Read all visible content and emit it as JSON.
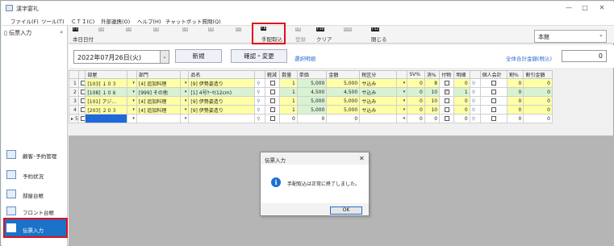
{
  "window": {
    "title": "漢字宴礼",
    "minimize": "—",
    "maximize": "□",
    "close": "✕"
  },
  "menu": [
    "ファイル(F)",
    "ツール(T)",
    "ＣＴＩ(C)",
    "外部連携(O)",
    "ヘルプ(H)",
    "チャットボット質問(Q)"
  ],
  "sidebar": {
    "header": "伝票入力",
    "collapse": "«",
    "items": [
      {
        "label": "顧客･予約管理",
        "icon": "customer-icon"
      },
      {
        "label": "予約状況",
        "icon": "calendar-icon"
      },
      {
        "label": "部屋台帳",
        "icon": "ledger-icon"
      },
      {
        "label": "フロント台帳",
        "icon": "front-ledger-icon"
      },
      {
        "label": "伝票入力",
        "icon": "slip-icon",
        "active": true
      }
    ]
  },
  "fkeys": [
    {
      "key": "F1",
      "label": "本日日付",
      "enabled": true
    },
    {
      "key": "F2",
      "label": "",
      "enabled": false
    },
    {
      "key": "F3",
      "label": "",
      "enabled": false
    },
    {
      "key": "F4",
      "label": "",
      "enabled": false
    },
    {
      "key": "F5",
      "label": "",
      "enabled": false
    },
    {
      "key": "F6",
      "label": "",
      "enabled": false
    },
    {
      "key": "F7",
      "label": "",
      "enabled": false
    },
    {
      "key": "F8",
      "label": "手配取込",
      "enabled": true
    },
    {
      "key": "F9",
      "label": "登録",
      "enabled": false
    },
    {
      "key": "F10",
      "label": "クリア",
      "enabled": true
    },
    {
      "key": "F11",
      "label": "",
      "enabled": false
    },
    {
      "key": "F12",
      "label": "閉じる",
      "enabled": true
    }
  ],
  "store_select": {
    "value": "本館",
    "chevron": "⌄"
  },
  "toolbar": {
    "date": "2022年07月26日(火)",
    "date_dd": "⌄",
    "new_button": "新規",
    "confirm_button": "確認・変更",
    "select_detail_link": "選択明細",
    "total_link": "全体合計金額(税込)",
    "total_value": "0"
  },
  "grid": {
    "headers": [
      "",
      "",
      "部屋",
      "",
      "部門",
      "",
      "品名",
      "",
      "軽減",
      "数量",
      "単価",
      "金額",
      "税区分",
      "",
      "SV%",
      "消%",
      "付物",
      "明細",
      "",
      "個人会計",
      "割%",
      "割引金額"
    ],
    "rows": [
      {
        "no": "1",
        "room": "[103] １０３",
        "dept": "[4] 追加料理",
        "item": "[9] 伊勢姿造り",
        "qty": "1",
        "price": "5,000",
        "amount": "5,000",
        "tax": "サ込み",
        "sv": "0",
        "con": "8",
        "att": false,
        "detail": "0",
        "disc": "0",
        "discamt": "0"
      },
      {
        "no": "2",
        "room": "[108] １０８",
        "dept": "[999] その他",
        "item": "[1] 4号ｹｰｷ(12cm)",
        "qty": "1",
        "price": "4,500",
        "amount": "4,500",
        "tax": "サ込み",
        "sv": "0",
        "con": "10",
        "att": true,
        "detail": "1",
        "disc": "0",
        "discamt": "0"
      },
      {
        "no": "3",
        "room": "[101] アジ…",
        "dept": "[4] 追加料理",
        "item": "[9] 伊勢姿造り",
        "qty": "1",
        "price": "5,000",
        "amount": "5,000",
        "tax": "サ込み",
        "sv": "0",
        "con": "10",
        "att": false,
        "detail": "0",
        "disc": "0",
        "discamt": "0"
      },
      {
        "no": "4",
        "room": "[203] ２０３",
        "dept": "[4] 追加料理",
        "item": "[9] 伊勢姿造り",
        "qty": "1",
        "price": "5,000",
        "amount": "5,000",
        "tax": "サ込み",
        "sv": "0",
        "con": "10",
        "att": false,
        "detail": "0",
        "disc": "0",
        "discamt": "0"
      },
      {
        "no": "5",
        "room": "",
        "dept": "",
        "item": "",
        "qty": "0",
        "price": "0",
        "amount": "0",
        "tax": "",
        "sv": "0",
        "con": "0",
        "att": false,
        "detail": "0",
        "disc": "0",
        "discamt": "0"
      }
    ],
    "row_pointer": "▸"
  },
  "dialog": {
    "title": "伝票入力",
    "close": "✕",
    "icon_glyph": "i",
    "message": "手配取込は正常に終了しました。",
    "ok": "OK"
  }
}
